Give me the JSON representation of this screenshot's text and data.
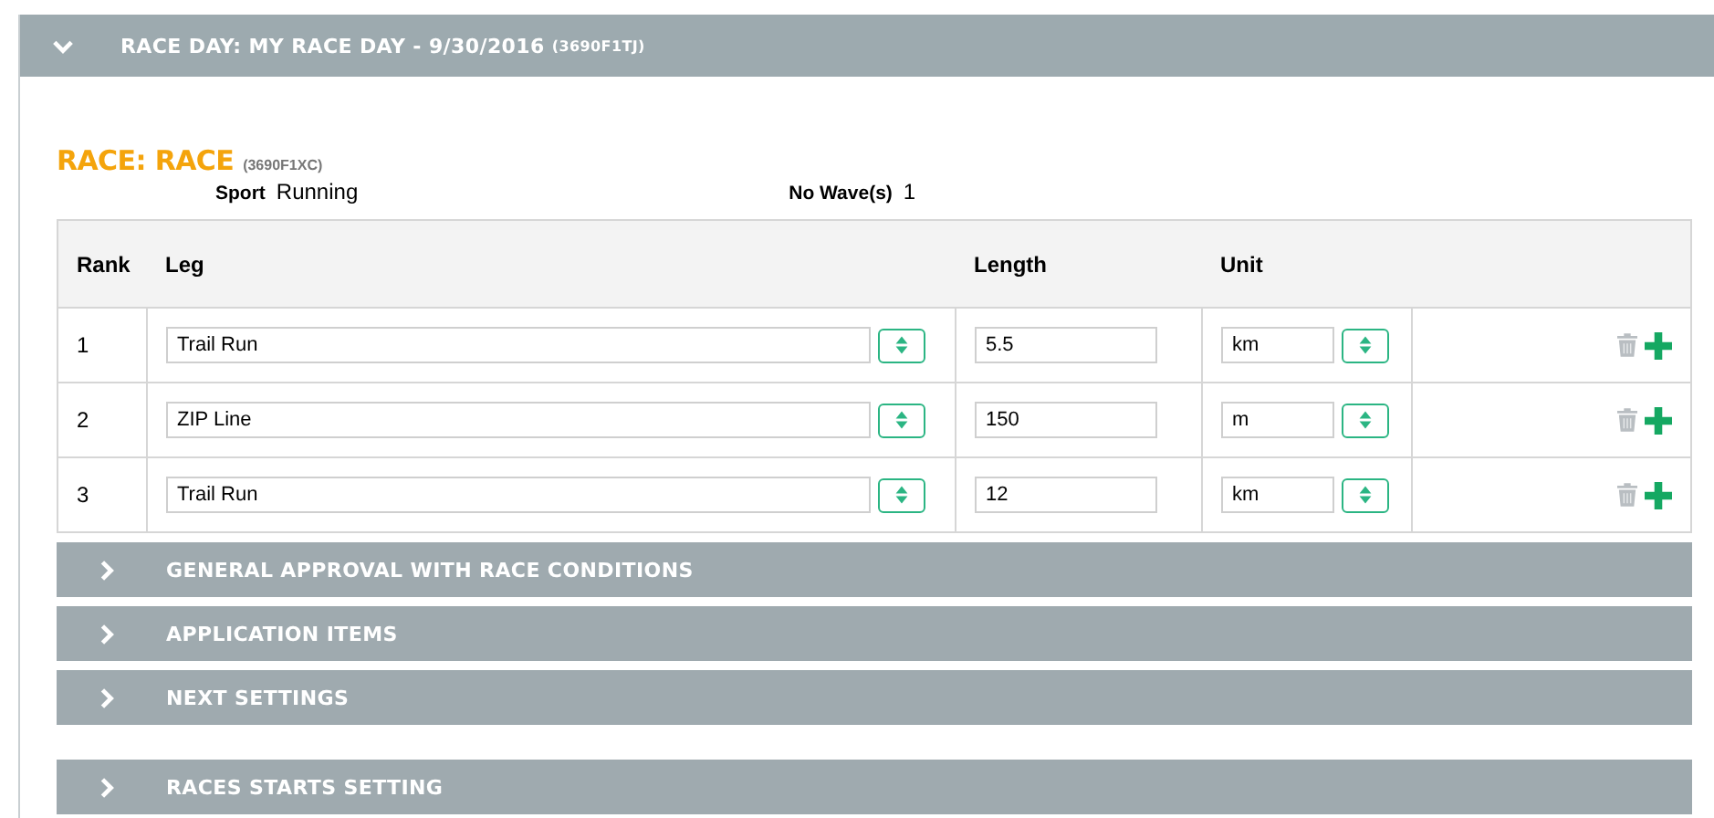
{
  "race_day": {
    "title": "RACE DAY: MY RACE DAY - 9/30/2016",
    "code": "(3690F1TJ)",
    "expanded": true
  },
  "race": {
    "title": "RACE: RACE",
    "code": "(3690F1XC)",
    "sport_label": "Sport",
    "sport": "Running",
    "waves_label": "No Wave(s)",
    "waves": "1"
  },
  "table": {
    "columns": [
      "Rank",
      "Leg",
      "Length",
      "Unit"
    ],
    "rows": [
      {
        "rank": "1",
        "leg": "Trail Run",
        "length": "5.5",
        "unit": "km"
      },
      {
        "rank": "2",
        "leg": "ZIP Line",
        "length": "150",
        "unit": "m"
      },
      {
        "rank": "3",
        "leg": "Trail Run",
        "length": "12",
        "unit": "km"
      }
    ]
  },
  "sections": [
    {
      "title": "GENERAL APPROVAL WITH RACE CONDITIONS",
      "expanded": false
    },
    {
      "title": "APPLICATION ITEMS",
      "expanded": false
    },
    {
      "title": "NEXT SETTINGS",
      "expanded": false
    }
  ],
  "sections_2": [
    {
      "title": "RACES STARTS SETTING",
      "expanded": false
    }
  ]
}
